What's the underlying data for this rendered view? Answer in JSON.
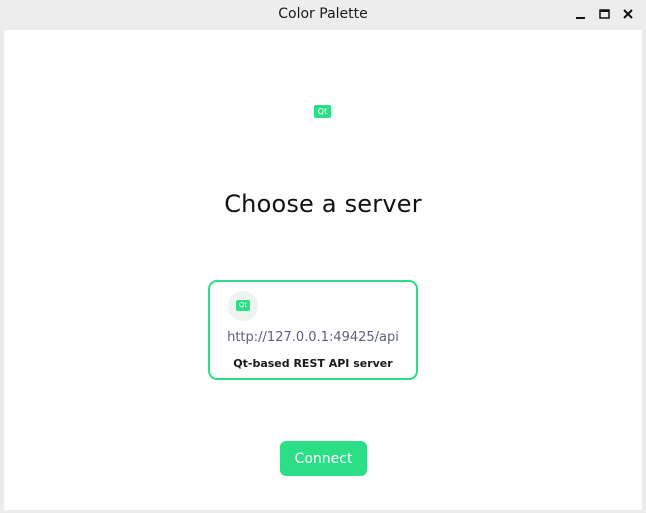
{
  "window": {
    "title": "Color Palette",
    "controls": {
      "minimize_icon": "minimize-icon",
      "maximize_icon": "maximize-icon",
      "close_icon": "close-icon"
    }
  },
  "logo": {
    "text": "Qt",
    "color": "#2cde85"
  },
  "heading": "Choose a server",
  "servers": [
    {
      "icon_text": "Qt",
      "url": "http://127.0.0.1:49425/api",
      "name": "Qt-based REST API server",
      "selected": true
    }
  ],
  "connect_label": "Connect",
  "colors": {
    "accent": "#2cde85",
    "background": "#ffffff",
    "titlebar": "#ededed"
  }
}
